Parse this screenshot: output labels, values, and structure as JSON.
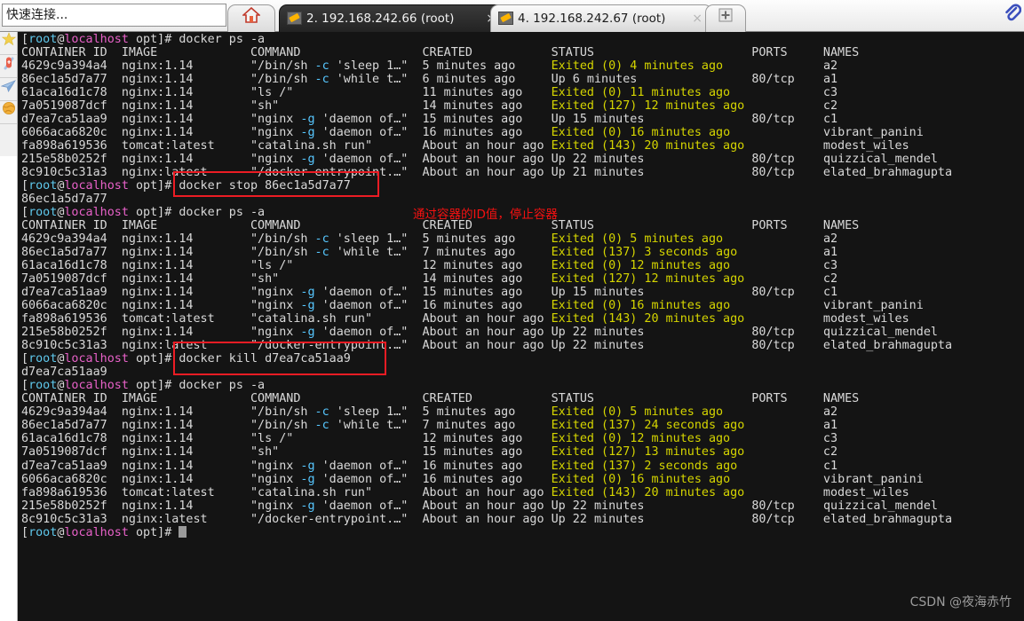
{
  "topbar": {
    "quick_connect_placeholder": "快速连接...",
    "home_icon": "home-icon",
    "clip_icon": "paperclip-icon",
    "new_tab_label": "+",
    "close_label": "×",
    "tabs": [
      {
        "label": "2. 192.168.242.66 (root)",
        "active": true,
        "icon": "terminal-key-icon"
      },
      {
        "label": "4. 192.168.242.67 (root)",
        "active": false,
        "icon": "terminal-key-icon"
      }
    ]
  },
  "sidebar": {
    "items": [
      {
        "name": "favorites-star-icon",
        "glyph": "★",
        "color": "#f0c419"
      },
      {
        "name": "toolbox-knife-icon",
        "glyph": "⚔",
        "color": "#e2574c"
      },
      {
        "name": "send-paper-plane-icon",
        "glyph": "➤",
        "color": "#8cb6e0"
      },
      {
        "name": "globe-icon",
        "glyph": "●",
        "color": "#f0a83c"
      }
    ]
  },
  "terminal": {
    "prompt_user": "root",
    "prompt_host": "localhost",
    "prompt_dir": "opt",
    "prompt_symbol": "]# ",
    "headers": [
      "CONTAINER ID",
      "IMAGE",
      "COMMAND",
      "CREATED",
      "STATUS",
      "PORTS",
      "NAMES"
    ],
    "commands": {
      "ps_a": "docker ps -a",
      "stop": "docker stop 86ec1a5d7a77",
      "stop_output": "86ec1a5d7a77",
      "kill": "docker kill d7ea7ca51aa9",
      "kill_output": "d7ea7ca51aa9"
    },
    "blocks": [
      {
        "id": "ps-block-1",
        "rows": [
          {
            "cid": "4629c9a394a4",
            "image": "nginx:1.14",
            "command": "\"/bin/sh -c 'sleep 1…\"",
            "created": "5 minutes ago",
            "status": "Exited (0) 4 minutes ago",
            "status_state": "exited",
            "ports": "",
            "names": "a2"
          },
          {
            "cid": "86ec1a5d7a77",
            "image": "nginx:1.14",
            "command": "\"/bin/sh -c 'while t…\"",
            "created": "6 minutes ago",
            "status": "Up 6 minutes",
            "status_state": "up",
            "ports": "80/tcp",
            "names": "a1"
          },
          {
            "cid": "61aca16d1c78",
            "image": "nginx:1.14",
            "command": "\"ls /\"",
            "created": "11 minutes ago",
            "status": "Exited (0) 11 minutes ago",
            "status_state": "exited",
            "ports": "",
            "names": "c3"
          },
          {
            "cid": "7a0519087dcf",
            "image": "nginx:1.14",
            "command": "\"sh\"",
            "created": "14 minutes ago",
            "status": "Exited (127) 12 minutes ago",
            "status_state": "exited",
            "ports": "",
            "names": "c2"
          },
          {
            "cid": "d7ea7ca51aa9",
            "image": "nginx:1.14",
            "command": "\"nginx -g 'daemon of…\"",
            "created": "15 minutes ago",
            "status": "Up 15 minutes",
            "status_state": "up",
            "ports": "80/tcp",
            "names": "c1"
          },
          {
            "cid": "6066aca6820c",
            "image": "nginx:1.14",
            "command": "\"nginx -g 'daemon of…\"",
            "created": "16 minutes ago",
            "status": "Exited (0) 16 minutes ago",
            "status_state": "exited",
            "ports": "",
            "names": "vibrant_panini"
          },
          {
            "cid": "fa898a619536",
            "image": "tomcat:latest",
            "command": "\"catalina.sh run\"",
            "created": "About an hour ago",
            "status": "Exited (143) 20 minutes ago",
            "status_state": "exited",
            "ports": "",
            "names": "modest_wiles"
          },
          {
            "cid": "215e58b0252f",
            "image": "nginx:1.14",
            "command": "\"nginx -g 'daemon of…\"",
            "created": "About an hour ago",
            "status": "Up 22 minutes",
            "status_state": "up",
            "ports": "80/tcp",
            "names": "quizzical_mendel"
          },
          {
            "cid": "8c910c5c31a3",
            "image": "nginx:latest",
            "command": "\"/docker-entrypoint.…\"",
            "created": "About an hour ago",
            "status": "Up 21 minutes",
            "status_state": "up",
            "ports": "80/tcp",
            "names": "elated_brahmagupta"
          }
        ]
      },
      {
        "id": "ps-block-2",
        "rows": [
          {
            "cid": "4629c9a394a4",
            "image": "nginx:1.14",
            "command": "\"/bin/sh -c 'sleep 1…\"",
            "created": "5 minutes ago",
            "status": "Exited (0) 5 minutes ago",
            "status_state": "exited",
            "ports": "",
            "names": "a2"
          },
          {
            "cid": "86ec1a5d7a77",
            "image": "nginx:1.14",
            "command": "\"/bin/sh -c 'while t…\"",
            "created": "7 minutes ago",
            "status": "Exited (137) 3 seconds ago",
            "status_state": "exited",
            "ports": "",
            "names": "a1"
          },
          {
            "cid": "61aca16d1c78",
            "image": "nginx:1.14",
            "command": "\"ls /\"",
            "created": "12 minutes ago",
            "status": "Exited (0) 12 minutes ago",
            "status_state": "exited",
            "ports": "",
            "names": "c3"
          },
          {
            "cid": "7a0519087dcf",
            "image": "nginx:1.14",
            "command": "\"sh\"",
            "created": "14 minutes ago",
            "status": "Exited (127) 12 minutes ago",
            "status_state": "exited",
            "ports": "",
            "names": "c2"
          },
          {
            "cid": "d7ea7ca51aa9",
            "image": "nginx:1.14",
            "command": "\"nginx -g 'daemon of…\"",
            "created": "15 minutes ago",
            "status": "Up 15 minutes",
            "status_state": "up",
            "ports": "80/tcp",
            "names": "c1"
          },
          {
            "cid": "6066aca6820c",
            "image": "nginx:1.14",
            "command": "\"nginx -g 'daemon of…\"",
            "created": "16 minutes ago",
            "status": "Exited (0) 16 minutes ago",
            "status_state": "exited",
            "ports": "",
            "names": "vibrant_panini"
          },
          {
            "cid": "fa898a619536",
            "image": "tomcat:latest",
            "command": "\"catalina.sh run\"",
            "created": "About an hour ago",
            "status": "Exited (143) 20 minutes ago",
            "status_state": "exited",
            "ports": "",
            "names": "modest_wiles"
          },
          {
            "cid": "215e58b0252f",
            "image": "nginx:1.14",
            "command": "\"nginx -g 'daemon of…\"",
            "created": "About an hour ago",
            "status": "Up 22 minutes",
            "status_state": "up",
            "ports": "80/tcp",
            "names": "quizzical_mendel"
          },
          {
            "cid": "8c910c5c31a3",
            "image": "nginx:latest",
            "command": "\"/docker-entrypoint.…\"",
            "created": "About an hour ago",
            "status": "Up 22 minutes",
            "status_state": "up",
            "ports": "80/tcp",
            "names": "elated_brahmagupta"
          }
        ]
      },
      {
        "id": "ps-block-3",
        "rows": [
          {
            "cid": "4629c9a394a4",
            "image": "nginx:1.14",
            "command": "\"/bin/sh -c 'sleep 1…\"",
            "created": "5 minutes ago",
            "status": "Exited (0) 5 minutes ago",
            "status_state": "exited",
            "ports": "",
            "names": "a2"
          },
          {
            "cid": "86ec1a5d7a77",
            "image": "nginx:1.14",
            "command": "\"/bin/sh -c 'while t…\"",
            "created": "7 minutes ago",
            "status": "Exited (137) 24 seconds ago",
            "status_state": "exited",
            "ports": "",
            "names": "a1"
          },
          {
            "cid": "61aca16d1c78",
            "image": "nginx:1.14",
            "command": "\"ls /\"",
            "created": "12 minutes ago",
            "status": "Exited (0) 12 minutes ago",
            "status_state": "exited",
            "ports": "",
            "names": "c3"
          },
          {
            "cid": "7a0519087dcf",
            "image": "nginx:1.14",
            "command": "\"sh\"",
            "created": "15 minutes ago",
            "status": "Exited (127) 13 minutes ago",
            "status_state": "exited",
            "ports": "",
            "names": "c2"
          },
          {
            "cid": "d7ea7ca51aa9",
            "image": "nginx:1.14",
            "command": "\"nginx -g 'daemon of…\"",
            "created": "16 minutes ago",
            "status": "Exited (137) 2 seconds ago",
            "status_state": "exited",
            "ports": "",
            "names": "c1"
          },
          {
            "cid": "6066aca6820c",
            "image": "nginx:1.14",
            "command": "\"nginx -g 'daemon of…\"",
            "created": "16 minutes ago",
            "status": "Exited (0) 16 minutes ago",
            "status_state": "exited",
            "ports": "",
            "names": "vibrant_panini"
          },
          {
            "cid": "fa898a619536",
            "image": "tomcat:latest",
            "command": "\"catalina.sh run\"",
            "created": "About an hour ago",
            "status": "Exited (143) 20 minutes ago",
            "status_state": "exited",
            "ports": "",
            "names": "modest_wiles"
          },
          {
            "cid": "215e58b0252f",
            "image": "nginx:1.14",
            "command": "\"nginx -g 'daemon of…\"",
            "created": "About an hour ago",
            "status": "Up 22 minutes",
            "status_state": "up",
            "ports": "80/tcp",
            "names": "quizzical_mendel"
          },
          {
            "cid": "8c910c5c31a3",
            "image": "nginx:latest",
            "command": "\"/docker-entrypoint.…\"",
            "created": "About an hour ago",
            "status": "Up 22 minutes",
            "status_state": "up",
            "ports": "80/tcp",
            "names": "elated_brahmagupta"
          }
        ]
      }
    ]
  },
  "annotations": {
    "note_text": "通过容器的ID值，停止容器",
    "note_color": "#f51111",
    "box_color": "#ec1c24",
    "boxes": [
      {
        "name": "docker-stop-highlight"
      },
      {
        "name": "docker-kill-highlight"
      }
    ]
  },
  "watermark": {
    "text": "CSDN @夜海赤竹"
  }
}
